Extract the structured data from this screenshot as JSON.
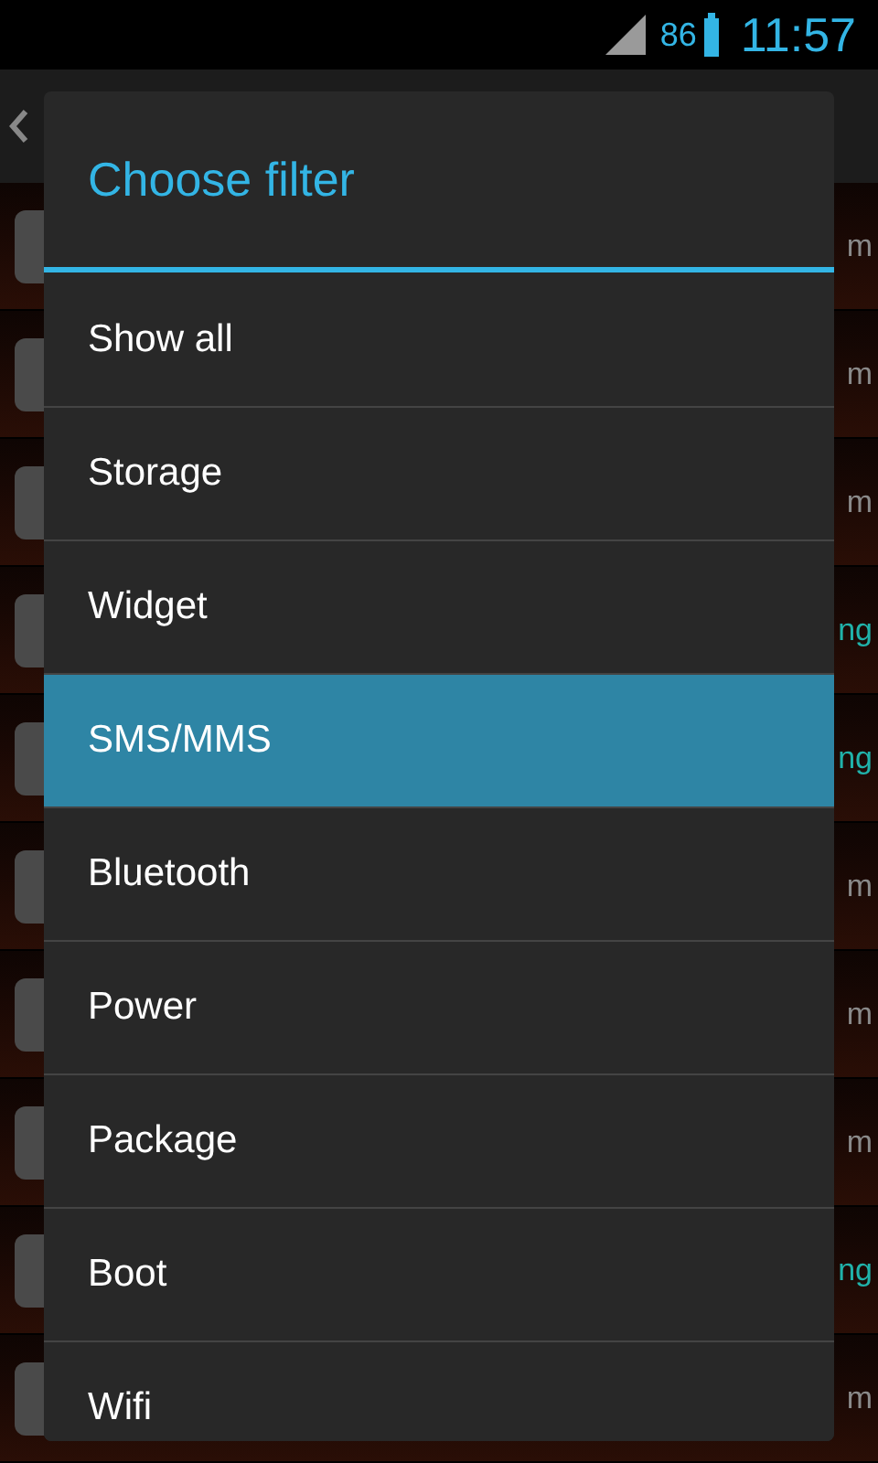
{
  "status_bar": {
    "battery": "86",
    "time": "11:57"
  },
  "background_rows": [
    {
      "status": "m",
      "kind": "warn"
    },
    {
      "status": "m",
      "kind": "warn"
    },
    {
      "status": "m",
      "kind": "warn"
    },
    {
      "status": "ng",
      "kind": "ok"
    },
    {
      "status": "ng",
      "kind": "ok"
    },
    {
      "status": "m",
      "kind": "warn"
    },
    {
      "status": "m",
      "kind": "warn"
    },
    {
      "status": "m",
      "kind": "warn"
    },
    {
      "status": "ng",
      "kind": "ok"
    },
    {
      "status": "m",
      "kind": "warn"
    }
  ],
  "dialog": {
    "title": "Choose filter",
    "options": [
      {
        "label": "Show all",
        "selected": false
      },
      {
        "label": "Storage",
        "selected": false
      },
      {
        "label": "Widget",
        "selected": false
      },
      {
        "label": "SMS/MMS",
        "selected": true
      },
      {
        "label": "Bluetooth",
        "selected": false
      },
      {
        "label": "Power",
        "selected": false
      },
      {
        "label": "Package",
        "selected": false
      },
      {
        "label": "Boot",
        "selected": false
      },
      {
        "label": "Wifi",
        "selected": false
      }
    ]
  }
}
